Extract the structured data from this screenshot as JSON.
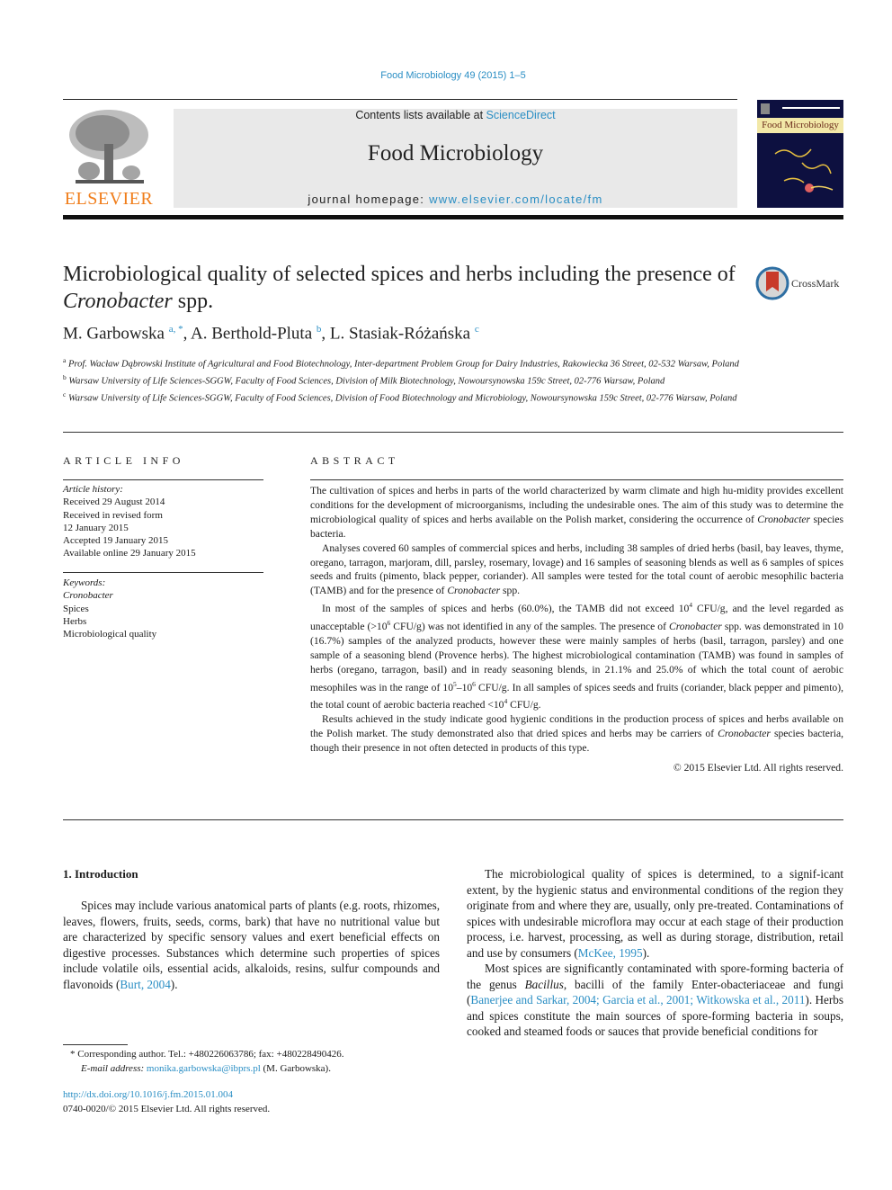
{
  "journal_ref": "Food Microbiology 49 (2015) 1–5",
  "header": {
    "publisher": "ELSEVIER",
    "contents_prefix": "Contents lists available at ",
    "contents_link": "ScienceDirect",
    "journal_name": "Food Microbiology",
    "homepage_prefix": "journal homepage: ",
    "homepage_link": "www.elsevier.com/locate/fm",
    "cover_title": "Food Microbiology"
  },
  "article": {
    "title_part1": "Microbiological quality of selected spices and herbs including the presence of ",
    "title_italic": "Cronobacter",
    "title_part2": " spp.",
    "crossmark_label": "CrossMark",
    "authors": [
      {
        "name": "M. Garbowska",
        "sup": "a, *"
      },
      {
        "name": "A. Berthold-Pluta",
        "sup": "b"
      },
      {
        "name": "L. Stasiak-Różańska",
        "sup": "c"
      }
    ],
    "affiliations": [
      {
        "sup": "a",
        "text": "Prof. Wacław Dąbrowski Institute of Agricultural and Food Biotechnology, Inter-department Problem Group for Dairy Industries, Rakowiecka 36 Street, 02-532 Warsaw, Poland"
      },
      {
        "sup": "b",
        "text": "Warsaw University of Life Sciences-SGGW, Faculty of Food Sciences, Division of Milk Biotechnology, Nowoursynowska 159c Street, 02-776 Warsaw, Poland"
      },
      {
        "sup": "c",
        "text": "Warsaw University of Life Sciences-SGGW, Faculty of Food Sciences, Division of Food Biotechnology and Microbiology, Nowoursynowska 159c Street, 02-776 Warsaw, Poland"
      }
    ]
  },
  "article_info": {
    "heading": "ARTICLE INFO",
    "history_label": "Article history:",
    "history": [
      "Received 29 August 2014",
      "Received in revised form",
      "12 January 2015",
      "Accepted 19 January 2015",
      "Available online 29 January 2015"
    ],
    "keywords_label": "Keywords:",
    "keywords": [
      "Cronobacter",
      "Spices",
      "Herbs",
      "Microbiological quality"
    ]
  },
  "abstract": {
    "heading": "ABSTRACT",
    "p1a": "The cultivation of spices and herbs in parts of the world characterized by warm climate and high hu-midity provides excellent conditions for the development of microorganisms, including the undesirable ones. The aim of this study was to determine the microbiological quality of spices and herbs available on the Polish market, considering the occurrence of ",
    "p1i": "Cronobacter",
    "p1b": " species bacteria.",
    "p2a": "Analyses covered 60 samples of commercial spices and herbs, including 38 samples of dried herbs (basil, bay leaves, thyme, oregano, tarragon, marjoram, dill, parsley, rosemary, lovage) and 16 samples of seasoning blends as well as 6 samples of spices seeds and fruits (pimento, black pepper, coriander). All samples were tested for the total count of aerobic mesophilic bacteria (TAMB) and for the presence of ",
    "p2i": "Cronobacter",
    "p2b": " spp.",
    "p3a": "In most of the samples of spices and herbs (60.0%), the TAMB did not exceed 10",
    "p3s1": "4",
    "p3b": " CFU/g, and the level regarded as unacceptable (>10",
    "p3s2": "6",
    "p3c": " CFU/g) was not identified in any of the samples. The presence of ",
    "p3i": "Cronobacter",
    "p3d": " spp. was demonstrated in 10 (16.7%) samples of the analyzed products, however these were mainly samples of herbs (basil, tarragon, parsley) and one sample of a seasoning blend (Provence herbs). The highest microbiological contamination (TAMB) was found in samples of herbs (oregano, tarragon, basil) and in ready seasoning blends, in 21.1% and 25.0% of which the total count of aerobic mesophiles was in the range of 10",
    "p3s3": "5",
    "p3e": "–10",
    "p3s4": "6",
    "p3f": " CFU/g. In all samples of spices seeds and fruits (coriander, black pepper and pimento), the total count of aerobic bacteria reached <10",
    "p3s5": "4",
    "p3g": " CFU/g.",
    "p4a": "Results achieved in the study indicate good hygienic conditions in the production process of spices and herbs available on the Polish market. The study demonstrated also that dried spices and herbs may be carriers of ",
    "p4i": "Cronobacter",
    "p4b": " species bacteria, though their presence in not often detected in products of this type.",
    "copyright": "© 2015 Elsevier Ltd. All rights reserved."
  },
  "body": {
    "section_heading": "1.  Introduction",
    "left_p1a": "Spices may include various anatomical parts of plants (e.g. roots, rhizomes, leaves, flowers, fruits, seeds, corms, bark) that have no nutritional value but are characterized by specific sensory values and exert beneficial effects on digestive processes. Substances which determine such properties of spices include volatile oils, essential acids, alkaloids, resins, sulfur compounds and flavonoids (",
    "left_cite1": "Burt, 2004",
    "left_p1b": ").",
    "right_p1a": "The microbiological quality of spices is determined, to a signif-icant extent, by the hygienic status and environmental conditions of the region they originate from and where they are, usually, only pre-treated. Contaminations of spices with undesirable microflora may occur at each stage of their production process, i.e. harvest, processing, as well as during storage, distribution, retail and use by consumers (",
    "right_cite1": "McKee, 1995",
    "right_p1b": ").",
    "right_p2a": "Most spices are significantly contaminated with spore-forming bacteria of the genus ",
    "right_p2i": "Bacillus",
    "right_p2b": ", bacilli of the family Enter-obacteriaceae and fungi (",
    "right_cite2": "Banerjee and Sarkar, 2004; Garcia et al., 2001; Witkowska et al., 2011",
    "right_p2c": "). Herbs and spices constitute the main sources of spore-forming bacteria in soups, cooked and steamed foods or sauces that provide beneficial conditions for"
  },
  "footnotes": {
    "corresponding": "*  Corresponding author. Tel.: +480226063786; fax: +480228490426.",
    "email_label": "E-mail address: ",
    "email": "monika.garbowska@ibprs.pl",
    "email_suffix": " (M. Garbowska).",
    "doi": "http://dx.doi.org/10.1016/j.fm.2015.01.004",
    "issn": "0740-0020/© 2015 Elsevier Ltd. All rights reserved."
  }
}
